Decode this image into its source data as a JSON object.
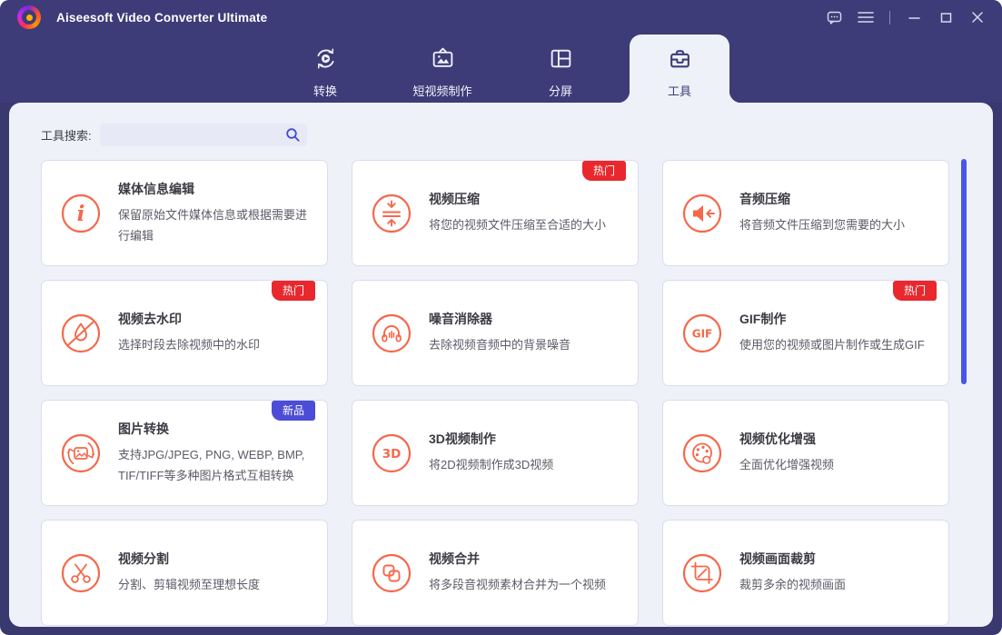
{
  "app": {
    "title": "Aiseesoft Video Converter Ultimate"
  },
  "titlebar": {
    "icons": [
      "feedback-icon",
      "menu-icon",
      "minimize-icon",
      "maximize-icon",
      "close-icon"
    ]
  },
  "tabs": [
    {
      "label": "转换",
      "icon": "convert-icon",
      "active": false
    },
    {
      "label": "短视频制作",
      "icon": "short-video-icon",
      "active": false
    },
    {
      "label": "分屏",
      "icon": "split-screen-icon",
      "active": false
    },
    {
      "label": "工具",
      "icon": "toolbox-icon",
      "active": true
    }
  ],
  "search": {
    "label": "工具搜索:",
    "value": "",
    "icon": "search-icon"
  },
  "badges": {
    "hot": "热门",
    "new": "新品"
  },
  "tools": [
    {
      "name": "媒体信息编辑",
      "desc": "保留原始文件媒体信息或根据需要进行编辑",
      "icon": "media-info-icon",
      "badge": null
    },
    {
      "name": "视频压缩",
      "desc": "将您的视频文件压缩至合适的大小",
      "icon": "video-compress-icon",
      "badge": "hot"
    },
    {
      "name": "音频压缩",
      "desc": "将音频文件压缩到您需要的大小",
      "icon": "audio-compress-icon",
      "badge": null
    },
    {
      "name": "视频去水印",
      "desc": "选择时段去除视频中的水印",
      "icon": "watermark-remove-icon",
      "badge": "hot"
    },
    {
      "name": "噪音消除器",
      "desc": "去除视频音频中的背景噪音",
      "icon": "noise-remover-icon",
      "badge": null
    },
    {
      "name": "GIF制作",
      "desc": "使用您的视频或图片制作或生成GIF",
      "icon": "gif-maker-icon",
      "badge": "hot"
    },
    {
      "name": "图片转换",
      "desc": "支持JPG/JPEG, PNG, WEBP, BMP, TIF/TIFF等多种图片格式互相转换",
      "icon": "image-convert-icon",
      "badge": "new"
    },
    {
      "name": "3D视频制作",
      "desc": "将2D视频制作成3D视频",
      "icon": "3d-video-icon",
      "badge": null
    },
    {
      "name": "视频优化增强",
      "desc": "全面优化增强视频",
      "icon": "video-enhance-icon",
      "badge": null
    },
    {
      "name": "视频分割",
      "desc": "分割、剪辑视频至理想长度",
      "icon": "video-split-icon",
      "badge": null
    },
    {
      "name": "视频合并",
      "desc": "将多段音视频素材合并为一个视频",
      "icon": "video-merge-icon",
      "badge": null
    },
    {
      "name": "视频画面裁剪",
      "desc": "裁剪多余的视频画面",
      "icon": "video-crop-icon",
      "badge": null
    }
  ],
  "colors": {
    "header": "#3d3c78",
    "frame": "#39386f",
    "panel": "#eff1f8",
    "card_border": "#dadcf0",
    "icon_accent": "#f5684a",
    "badge_hot": "#e8282d",
    "badge_new": "#4c4cd6",
    "scrollbar": "#4a55e8"
  }
}
